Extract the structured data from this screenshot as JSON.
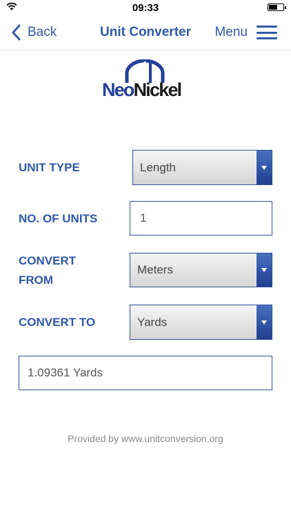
{
  "status": {
    "time": "09:33"
  },
  "nav": {
    "back_label": "Back",
    "title": "Unit Converter",
    "menu_label": "Menu"
  },
  "logo": {
    "text_neo": "Neo",
    "text_nickel": "Nickel"
  },
  "form": {
    "unit_type": {
      "label": "UNIT TYPE",
      "value": "Length"
    },
    "no_of_units": {
      "label": "NO. OF UNITS",
      "value": "1"
    },
    "convert_from": {
      "label_line1": "CONVERT",
      "label_line2": "FROM",
      "value": "Meters"
    },
    "convert_to": {
      "label": "CONVERT TO",
      "value": "Yards"
    }
  },
  "result": {
    "value": "1.09361 Yards"
  },
  "footer": {
    "text": "Provided by www.unitconversion.org"
  },
  "colors": {
    "accent": "#2f5aa8",
    "logo_blue": "#233f9b",
    "select_arrow": "#2a4a9a"
  },
  "icons": [
    "wifi-icon",
    "battery-icon",
    "chevron-left-icon",
    "hamburger-menu-icon",
    "dropdown-arrow-icon"
  ]
}
